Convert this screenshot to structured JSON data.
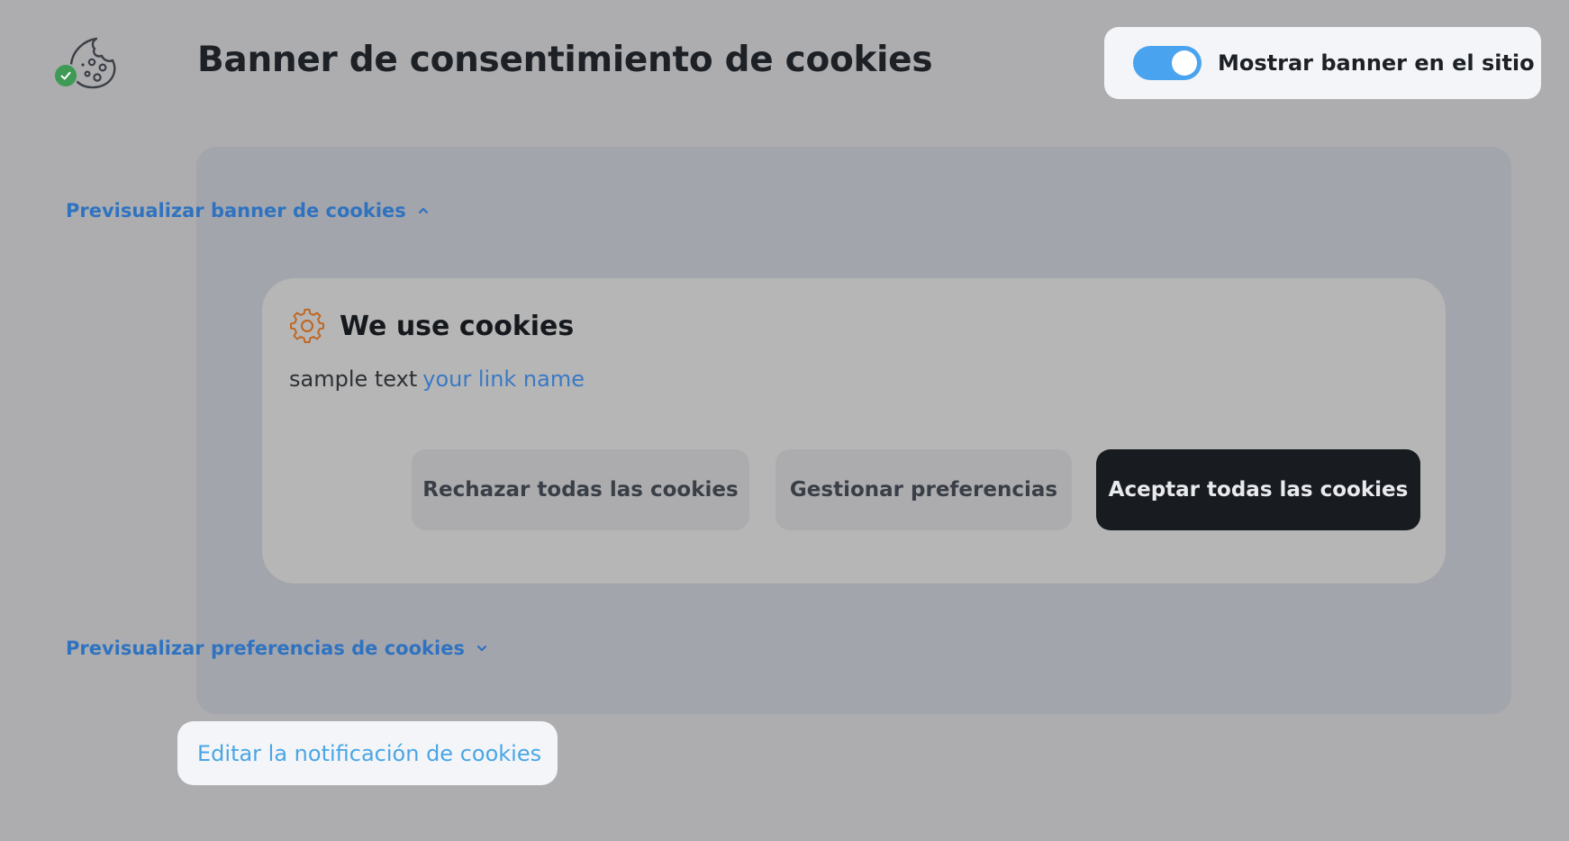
{
  "header": {
    "app_icon": "cookie-icon",
    "badge_icon": "check-icon",
    "title": "Banner de consentimiento de cookies",
    "toggle": {
      "label": "Mostrar banner en el sitio",
      "state": "on",
      "color": "#4aa3ee"
    }
  },
  "preview": {
    "banner_toggle_label": "Previsualizar banner de cookies",
    "banner_toggle_icon": "chevron-up-icon",
    "banner_expanded": true,
    "cookie_banner": {
      "icon": "gear-icon",
      "title": "We use cookies",
      "text": "sample text",
      "link_text": "your link name",
      "buttons": {
        "reject": "Rechazar todas las cookies",
        "manage": "Gestionar preferencias",
        "accept": "Aceptar todas las cookies"
      }
    },
    "preferences_toggle_label": "Previsualizar preferencias de cookies",
    "preferences_toggle_icon": "chevron-down-icon",
    "preferences_expanded": false
  },
  "footer": {
    "edit_link": "Editar la notificación de cookies"
  },
  "colors": {
    "background": "#adadaf",
    "link": "#2f73c0",
    "accept_button": "#181b1f",
    "success_badge": "#3e9a55",
    "gear_icon": "#c0641e"
  }
}
